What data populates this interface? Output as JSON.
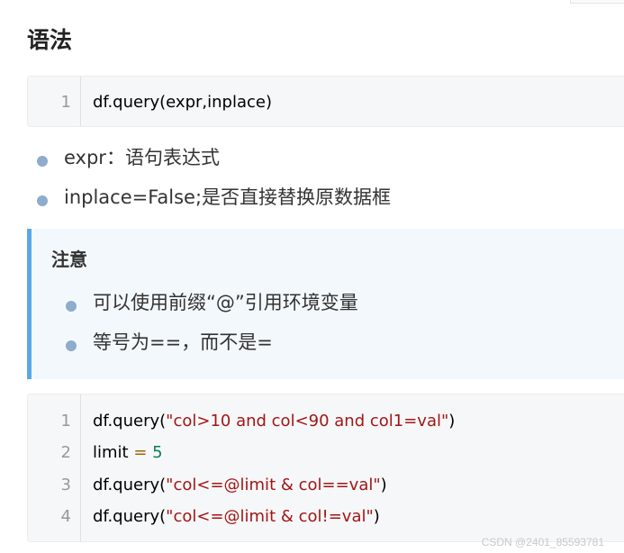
{
  "section_title": "语法",
  "syntax_code": {
    "lines": [
      {
        "n": "1",
        "fn": "df.query",
        "args": "(expr,inplace)"
      }
    ]
  },
  "params": [
    {
      "text": "expr：语句表达式"
    },
    {
      "text": "inplace=False;是否直接替换原数据框"
    }
  ],
  "note": {
    "title": "注意",
    "items": [
      {
        "text": "可以使用前缀“@”引用环境变量"
      },
      {
        "text": "等号为==，而不是="
      }
    ]
  },
  "example_code": {
    "line1": {
      "n": "1",
      "fn": "df.query",
      "open": "(",
      "str": "\"col>10 and col<90 and col1=val\"",
      "close": ")"
    },
    "line2": {
      "n": "2",
      "var": "limit ",
      "op": "=",
      "num": " 5"
    },
    "line3": {
      "n": "3",
      "fn": "df.query",
      "open": "(",
      "str": "\"col<=@limit & col==val\"",
      "close": ")"
    },
    "line4": {
      "n": "4",
      "fn": "df.query",
      "open": "(",
      "str": "\"col<=@limit & col!=val\"",
      "close": ")"
    }
  },
  "watermark": "CSDN @2401_85593781",
  "colors": {
    "accent": "#5aa9e6",
    "bullet": "#8eaccc",
    "string": "#a31515",
    "number": "#0b7e53"
  }
}
